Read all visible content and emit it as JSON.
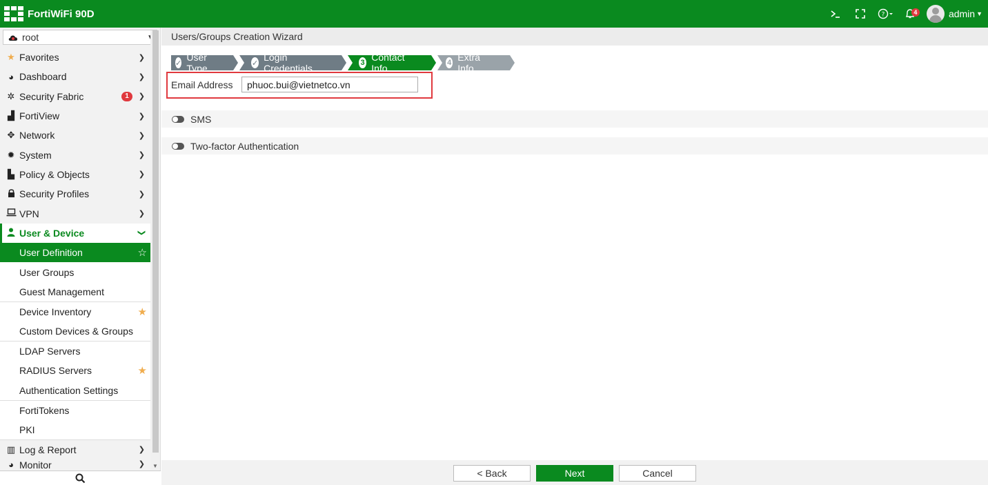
{
  "app": {
    "title": "FortiWiFi 90D",
    "user": "admin",
    "notifications": "4"
  },
  "vdom": {
    "value": "root"
  },
  "sidebar": {
    "items": [
      {
        "label": "Favorites",
        "icon": "star-icon"
      },
      {
        "label": "Dashboard",
        "icon": "dashboard-icon"
      },
      {
        "label": "Security Fabric",
        "icon": "fabric-icon",
        "badge": "1"
      },
      {
        "label": "FortiView",
        "icon": "chart-icon"
      },
      {
        "label": "Network",
        "icon": "network-icon"
      },
      {
        "label": "System",
        "icon": "gear-icon"
      },
      {
        "label": "Policy & Objects",
        "icon": "policy-icon"
      },
      {
        "label": "Security Profiles",
        "icon": "lock-icon"
      },
      {
        "label": "VPN",
        "icon": "laptop-icon"
      },
      {
        "label": "User & Device",
        "icon": "user-icon"
      }
    ],
    "subitems": [
      {
        "label": "User Definition"
      },
      {
        "label": "User Groups"
      },
      {
        "label": "Guest Management"
      },
      {
        "label": "Device Inventory"
      },
      {
        "label": "Custom Devices & Groups"
      },
      {
        "label": "LDAP Servers"
      },
      {
        "label": "RADIUS Servers"
      },
      {
        "label": "Authentication Settings"
      },
      {
        "label": "FortiTokens"
      },
      {
        "label": "PKI"
      }
    ],
    "after": [
      {
        "label": "Log & Report",
        "icon": "log-icon"
      },
      {
        "label": "Monitor",
        "icon": "monitor-icon"
      }
    ]
  },
  "page": {
    "title": "Users/Groups Creation Wizard"
  },
  "wizard": {
    "steps": [
      {
        "label": "User Type",
        "mark": "✓",
        "state": "done"
      },
      {
        "label": "Login Credentials",
        "mark": "✓",
        "state": "done"
      },
      {
        "label": "Contact Info",
        "mark": "3",
        "state": "current"
      },
      {
        "label": "Extra Info",
        "mark": "4",
        "state": "pending"
      }
    ]
  },
  "form": {
    "email_label": "Email Address",
    "email_value": "phuoc.bui@vietnetco.vn",
    "sms_label": "SMS",
    "twofactor_label": "Two-factor Authentication"
  },
  "buttons": {
    "back": "< Back",
    "next": "Next",
    "cancel": "Cancel"
  },
  "colors": {
    "brand": "#0a8a1f",
    "step_done": "#6f7c85",
    "step_pending": "#9aa3a9",
    "highlight": "#e0393e",
    "favorite": "#f0ad4e"
  }
}
